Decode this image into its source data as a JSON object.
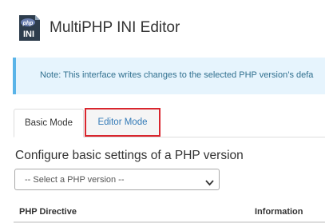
{
  "header": {
    "title": "MultiPHP INI Editor",
    "logo_icon": "php-ini-icon",
    "logo_text_top": "php",
    "logo_text_bottom": "INI"
  },
  "notice": {
    "text": "Note: This interface writes changes to the selected PHP version’s defa"
  },
  "tabs": [
    {
      "label": "Basic Mode",
      "active": true
    },
    {
      "label": "Editor Mode",
      "active": false,
      "highlighted": true
    }
  ],
  "section": {
    "title": "Configure basic settings of a PHP version"
  },
  "version_select": {
    "value": "-- Select a PHP version --",
    "icon": "chevron-down-icon"
  },
  "table": {
    "columns": [
      "PHP Directive",
      "Information"
    ]
  },
  "colors": {
    "notice_bg": "#e6f4fd",
    "notice_border": "#5ab4e8",
    "highlight": "#d9262e",
    "link": "#337ab7"
  }
}
